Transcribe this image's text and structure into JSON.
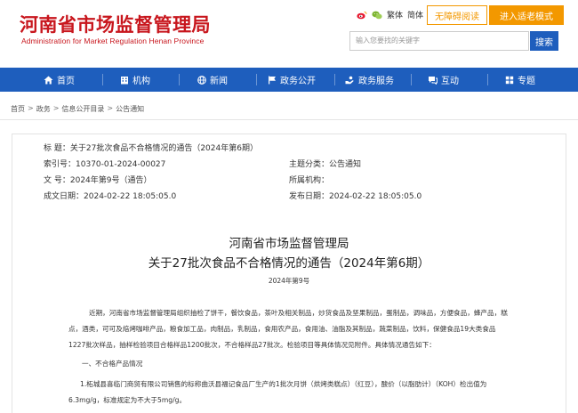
{
  "header": {
    "logo_cn": "河南省市场监督管理局",
    "logo_en": "Administration for Market Regulation Henan Province",
    "lang_traditional": "繁体",
    "lang_simplified": "简体",
    "accessibility_btn": "无障碍阅读",
    "elder_mode_btn": "进入适老模式",
    "search_placeholder": "输入您要找的关键字",
    "search_btn": "搜索"
  },
  "nav": {
    "items": [
      {
        "label": "首页",
        "icon": "home-icon"
      },
      {
        "label": "机构",
        "icon": "building-icon"
      },
      {
        "label": "新闻",
        "icon": "globe-icon"
      },
      {
        "label": "政务公开",
        "icon": "flag-icon"
      },
      {
        "label": "政务服务",
        "icon": "hand-icon"
      },
      {
        "label": "互动",
        "icon": "chat-icon"
      },
      {
        "label": "专题",
        "icon": "topic-icon"
      }
    ]
  },
  "breadcrumb": [
    "首页",
    "政务",
    "信息公开目录",
    "公告通知"
  ],
  "meta": {
    "title_label": "标    题：",
    "title_value": "关于27批次食品不合格情况的通告（2024年第6期）",
    "index_label": "索引号：",
    "index_value": "10370-01-2024-00027",
    "category_label": "主题分类：",
    "category_value": "公告通知",
    "docno_label": "文    号：",
    "docno_value": "2024年第9号（通告）",
    "org_label": "所属机构：",
    "org_value": "",
    "created_label": "成文日期：",
    "created_value": "2024-02-22 18:05:05.0",
    "published_label": "发布日期：",
    "published_value": "2024-02-22 18:05:05.0"
  },
  "article": {
    "title_line1": "河南省市场监督管理局",
    "title_line2": "关于27批次食品不合格情况的通告（2024年第6期）",
    "doc_number": "2024年第9号",
    "para1_line1": "近期，河南省市场监督管理局组织抽检了饼干，餐饮食品，茶叶及相关制品，炒货食品及坚果制品，蛋制品，调味品，方便食品，蜂产品，糕",
    "para1_line2": "点，酒类，可可及焙烤咖啡产品，粮食加工品，肉制品，乳制品，食用农产品，食用油、油脂及其制品，蔬菜制品，饮料，保健食品19大类食品",
    "para1_line3": "1227批次样品，抽样检验项目合格样品1200批次，不合格样品27批次。检验项目等具体情况见附件。具体情况通告如下：",
    "section1": "一、不合格产品情况",
    "item1_line1": "1.柘城县喜临门商贸有限公司销售的标称曲沃县福记食品厂生产的1批次月饼（烘烤类糕点）（红豆），酸价（以脂肪计）（KOH）检出值为",
    "item1_line2": "6.3mg/g，标准规定为不大于5mg/g。"
  },
  "colors": {
    "brand_red": "#c8161d",
    "nav_blue": "#1e5ebd",
    "accent_orange": "#f39800"
  }
}
